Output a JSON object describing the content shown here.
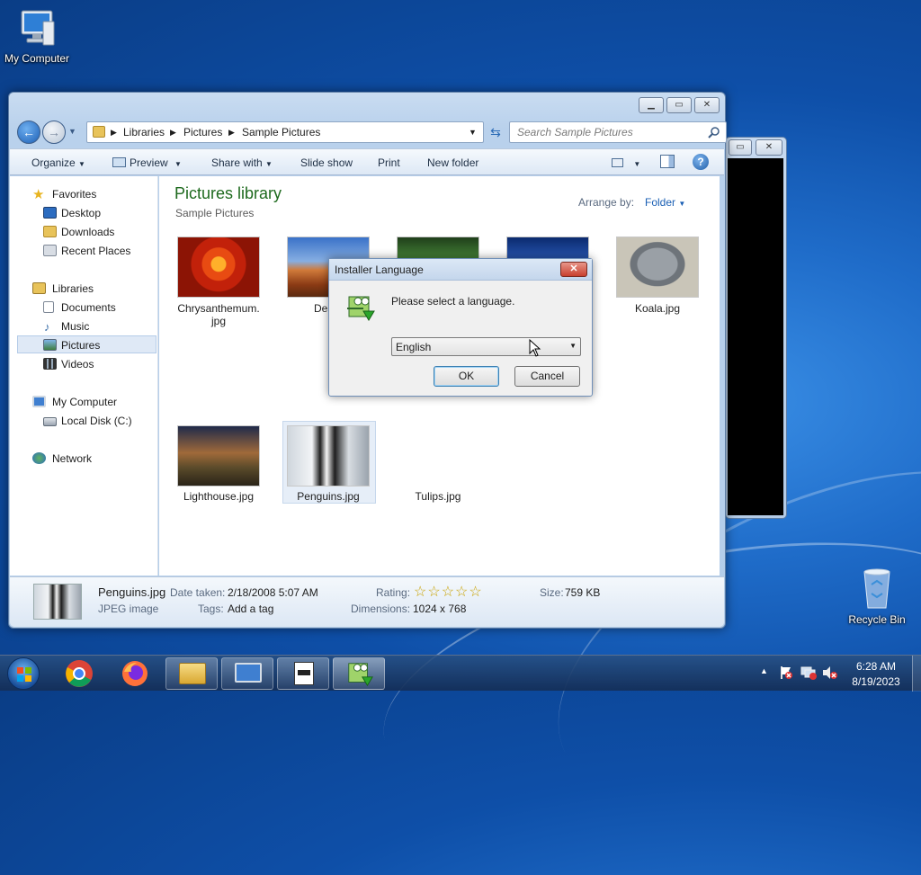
{
  "desktop": {
    "icons": [
      {
        "label": "My Computer",
        "icon": "computer-icon"
      },
      {
        "label": "Recycle Bin",
        "icon": "recycle-bin-icon"
      }
    ]
  },
  "explorer": {
    "breadcrumb": [
      "Libraries",
      "Pictures",
      "Sample Pictures"
    ],
    "search_placeholder": "Search Sample Pictures",
    "toolbar": {
      "organize": "Organize",
      "preview": "Preview",
      "share_with": "Share with",
      "slide_show": "Slide show",
      "print": "Print",
      "new_folder": "New folder"
    },
    "nav": {
      "favorites": "Favorites",
      "desktop": "Desktop",
      "downloads": "Downloads",
      "recent_places": "Recent Places",
      "libraries": "Libraries",
      "documents": "Documents",
      "music": "Music",
      "pictures": "Pictures",
      "videos": "Videos",
      "my_computer": "My Computer",
      "local_disk": "Local Disk (C:)",
      "network": "Network"
    },
    "library_title": "Pictures library",
    "library_subtitle": "Sample Pictures",
    "arrange_by_label": "Arrange by:",
    "arrange_by_value": "Folder",
    "files": [
      {
        "name_line1": "Chrysanthemum.",
        "name_line2": "jpg"
      },
      {
        "name_line1": "Deser",
        "name_line2": ""
      },
      {
        "name_line1": "",
        "name_line2": ""
      },
      {
        "name_line1": "",
        "name_line2": ""
      },
      {
        "name_line1": "Koala.jpg",
        "name_line2": ""
      },
      {
        "name_line1": "Lighthouse.jpg",
        "name_line2": ""
      },
      {
        "name_line1": "Penguins.jpg",
        "name_line2": ""
      },
      {
        "name_line1": "Tulips.jpg",
        "name_line2": ""
      }
    ],
    "details": {
      "filename": "Penguins.jpg",
      "filetype": "JPEG image",
      "date_taken_label": "Date taken:",
      "date_taken": "2/18/2008 5:07 AM",
      "tags_label": "Tags:",
      "tags": "Add a tag",
      "rating_label": "Rating:",
      "rating_stars": "☆☆☆☆☆",
      "dimensions_label": "Dimensions:",
      "dimensions": "1024 x 768",
      "size_label": "Size:",
      "size": "759 KB"
    }
  },
  "dialog": {
    "title": "Installer Language",
    "message": "Please select a language.",
    "selected_language": "English",
    "ok": "OK",
    "cancel": "Cancel"
  },
  "taskbar": {
    "time": "6:28 AM",
    "date": "8/19/2023"
  },
  "colors": {
    "library_title": "#1e6a1e",
    "link_blue": "#1a5fb4"
  }
}
